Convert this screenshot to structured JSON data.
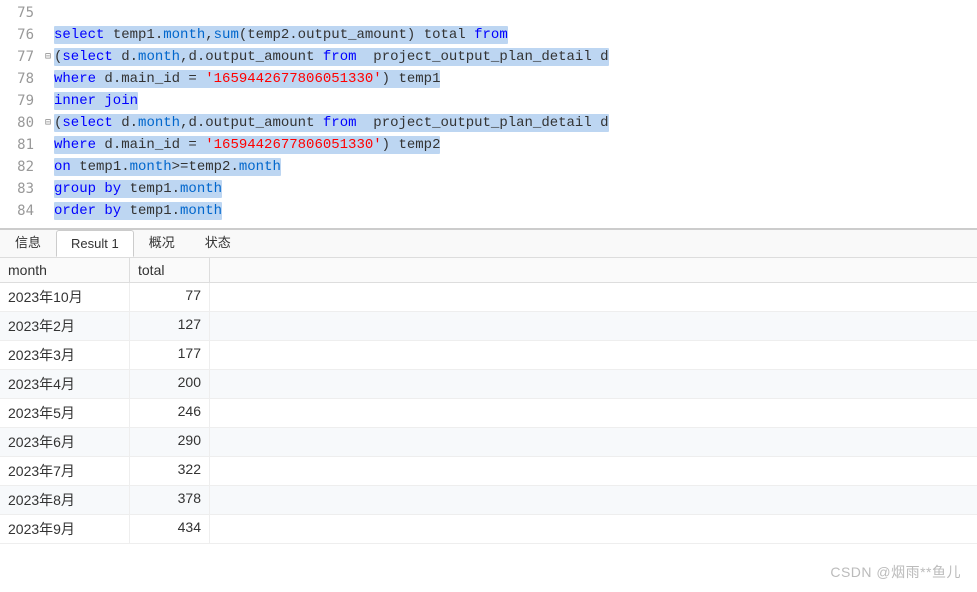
{
  "editor": {
    "lines": [
      {
        "num": "75",
        "fold": "",
        "segments": []
      },
      {
        "num": "76",
        "fold": "",
        "segments": [
          {
            "t": "select",
            "c": "kw"
          },
          {
            "t": " temp1."
          },
          {
            "t": "month",
            "c": "col"
          },
          {
            "t": ","
          },
          {
            "t": "sum",
            "c": "col"
          },
          {
            "t": "(temp2.output_amount) total "
          },
          {
            "t": "from",
            "c": "kw"
          }
        ]
      },
      {
        "num": "77",
        "fold": "⊟",
        "segments": [
          {
            "t": "("
          },
          {
            "t": "select",
            "c": "kw"
          },
          {
            "t": " d."
          },
          {
            "t": "month",
            "c": "col"
          },
          {
            "t": ",d.output_amount "
          },
          {
            "t": "from",
            "c": "kw"
          },
          {
            "t": "  project_output_plan_detail d"
          }
        ]
      },
      {
        "num": "78",
        "fold": "└",
        "segments": [
          {
            "t": "where",
            "c": "kw"
          },
          {
            "t": " d.main_id = "
          },
          {
            "t": "'1659442677806051330'",
            "c": "str"
          },
          {
            "t": ") temp1"
          }
        ]
      },
      {
        "num": "79",
        "fold": "",
        "segments": [
          {
            "t": "inner join",
            "c": "kw"
          }
        ]
      },
      {
        "num": "80",
        "fold": "⊟",
        "segments": [
          {
            "t": "("
          },
          {
            "t": "select",
            "c": "kw"
          },
          {
            "t": " d."
          },
          {
            "t": "month",
            "c": "col"
          },
          {
            "t": ",d.output_amount "
          },
          {
            "t": "from",
            "c": "kw"
          },
          {
            "t": "  project_output_plan_detail d"
          }
        ]
      },
      {
        "num": "81",
        "fold": "",
        "segments": [
          {
            "t": "where",
            "c": "kw"
          },
          {
            "t": " d.main_id = "
          },
          {
            "t": "'1659442677806051330'",
            "c": "str"
          },
          {
            "t": ") temp2"
          }
        ]
      },
      {
        "num": "82",
        "fold": "",
        "segments": [
          {
            "t": "on",
            "c": "kw"
          },
          {
            "t": " temp1."
          },
          {
            "t": "month",
            "c": "col"
          },
          {
            "t": ">=temp2."
          },
          {
            "t": "month",
            "c": "col"
          }
        ]
      },
      {
        "num": "83",
        "fold": "",
        "segments": [
          {
            "t": "group by",
            "c": "kw"
          },
          {
            "t": " temp1."
          },
          {
            "t": "month",
            "c": "col"
          }
        ]
      },
      {
        "num": "84",
        "fold": "",
        "segments": [
          {
            "t": "order by",
            "c": "kw"
          },
          {
            "t": " temp1."
          },
          {
            "t": "month",
            "c": "col"
          }
        ]
      }
    ]
  },
  "tabs": [
    {
      "label": "信息",
      "active": false
    },
    {
      "label": "Result 1",
      "active": true
    },
    {
      "label": "概况",
      "active": false
    },
    {
      "label": "状态",
      "active": false
    }
  ],
  "grid": {
    "headers": [
      "month",
      "total"
    ],
    "rows": [
      [
        "2023年10月",
        "77"
      ],
      [
        "2023年2月",
        "127"
      ],
      [
        "2023年3月",
        "177"
      ],
      [
        "2023年4月",
        "200"
      ],
      [
        "2023年5月",
        "246"
      ],
      [
        "2023年6月",
        "290"
      ],
      [
        "2023年7月",
        "322"
      ],
      [
        "2023年8月",
        "378"
      ],
      [
        "2023年9月",
        "434"
      ]
    ]
  },
  "watermark": "CSDN @烟雨**鱼儿"
}
